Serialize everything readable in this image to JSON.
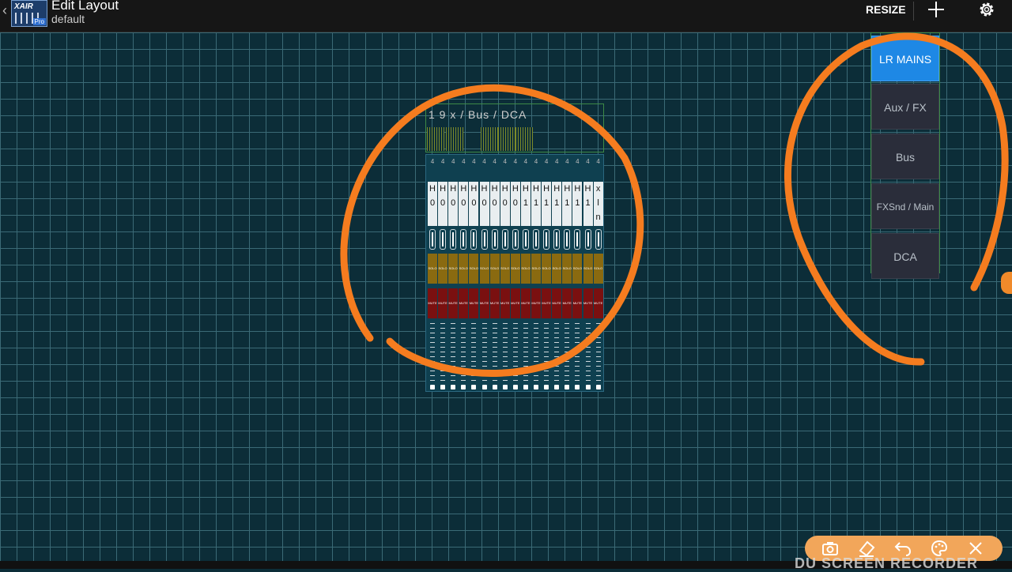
{
  "header": {
    "back_icon": "chevron-left-icon",
    "logo": {
      "text": "XAIR",
      "badge": "Pro"
    },
    "title": "Edit Layout",
    "subtitle": "default",
    "resize_label": "RESIZE",
    "add_icon": "plus-icon",
    "settings_icon": "gear-icon"
  },
  "mixer_widget": {
    "title": "1 9 x / Bus / DCA",
    "channel_numbers": [
      "4",
      "4",
      "4",
      "4",
      "4",
      "4",
      "4",
      "4",
      "4",
      "4",
      "4",
      "4",
      "4",
      "4",
      "4",
      "4",
      "4"
    ],
    "channel_name_top": [
      "H",
      "H",
      "H",
      "H",
      "H",
      "H",
      "H",
      "H",
      "H",
      "H",
      "H",
      "H",
      "H",
      "H",
      "H",
      "H",
      "x"
    ],
    "channel_name_mid": [
      "",
      "",
      "",
      "",
      "",
      "",
      "",
      "",
      "",
      "",
      "",
      "",
      "",
      "",
      "",
      "",
      "l"
    ],
    "channel_name_bot": [
      "0",
      "0",
      "0",
      "0",
      "0",
      "0",
      "0",
      "0",
      "0",
      "1",
      "1",
      "1",
      "1",
      "1",
      "1",
      "1",
      "n"
    ],
    "solo_label": "SOLO",
    "mute_label": "MUTE"
  },
  "side_panel": {
    "buttons": [
      {
        "label": "LR MAINS",
        "active": true
      },
      {
        "label": "Aux / FX",
        "active": false
      },
      {
        "label": "Bus",
        "active": false
      },
      {
        "label": "FXSnd / Main",
        "active": false
      },
      {
        "label": "DCA",
        "active": false
      }
    ]
  },
  "recorder": {
    "watermark": "DU SCREEN RECORDER",
    "icons": [
      "camera-icon",
      "eraser-icon",
      "undo-icon",
      "palette-icon",
      "close-icon"
    ]
  },
  "colors": {
    "grid_bg": "#0c2d38",
    "grid_line": "#3b6a76",
    "accent_blue": "#1e88e5",
    "annotation_orange": "#f57c1f",
    "solo": "#8a6a10",
    "mute": "#7a1010"
  }
}
